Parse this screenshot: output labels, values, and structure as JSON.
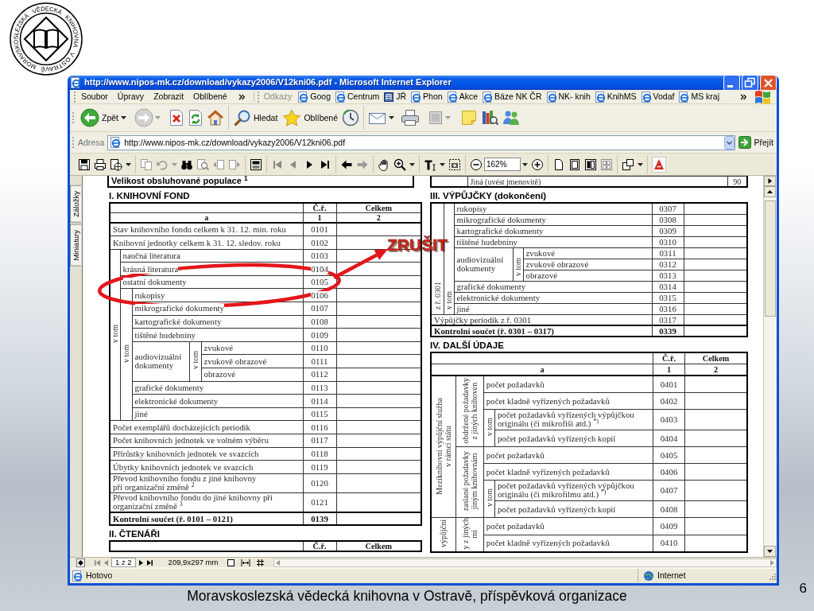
{
  "slide": {
    "logo_text": [
      "MORAVSKOSLEZSKÁ",
      "VĚDECKÁ",
      "KNIHOVNA",
      "V OSTRAVĚ"
    ]
  },
  "window": {
    "title": "http://www.nipos-mk.cz/download/vykazy2006/V12kni06.pdf - Microsoft Internet Explorer"
  },
  "menu": [
    "Soubor",
    "Úpravy",
    "Zobrazit",
    "Oblíbené"
  ],
  "links": {
    "label": "Odkazy",
    "items": [
      "Goog",
      "Centrum",
      "JŘ",
      "Phon",
      "Akce",
      "Báze NK ČR",
      "NK- knih",
      "KnihMS",
      "Vodaf",
      "MS kraj"
    ]
  },
  "toolbar": {
    "back": "Zpět",
    "search": "Hledat",
    "favorites": "Oblíbené"
  },
  "address_bar": {
    "label": "Adresa",
    "value": "http://www.nipos-mk.cz/download/vykazy2006/V12kni06.pdf",
    "go": "Přejít"
  },
  "pdf_toolbar": {
    "zoom": "162%"
  },
  "side_tabs": [
    "Záložky",
    "Miniatury"
  ],
  "document": {
    "left": [
      {
        "kind": "box",
        "text": "Velikost obsluhované populace $^{1}$"
      },
      {
        "kind": "heading",
        "text": "I. KNIHOVNÍ FOND"
      },
      {
        "kind": "table",
        "columns": [
          "Č.ř.",
          "Celkem"
        ],
        "keys": [
          "a",
          "1",
          "2"
        ],
        "rows": [
          {
            "label": "Stav knihovního fondu celkem k 31. 12. min. roku",
            "code": "0101"
          },
          {
            "label": "Knihovní jednotky celkem k 31. 12. sledov. roku",
            "code": "0102"
          },
          {
            "vlabel": "v tom",
            "children": [
              {
                "label": "naučná literatura",
                "code": "0103"
              },
              {
                "label": "krásná literatura",
                "code": "0104"
              },
              {
                "label": "ostatní dokumenty",
                "code": "0105"
              },
              {
                "vlabel": "v tom",
                "children": [
                  {
                    "label": "rukopisy",
                    "code": "0106"
                  },
                  {
                    "label": "mikrografické dokumenty",
                    "code": "0107"
                  },
                  {
                    "label": "kartografické dokumenty",
                    "code": "0108"
                  },
                  {
                    "label": "tištěné hudebniny",
                    "code": "0109"
                  },
                  {
                    "label": "audiovizuální dokumenty",
                    "vlabel": "v tom",
                    "children": [
                      {
                        "label": "zvukové",
                        "code": "0110"
                      },
                      {
                        "label": "zvukově obrazové",
                        "code": "0111"
                      },
                      {
                        "label": "obrazové",
                        "code": "0112"
                      }
                    ]
                  },
                  {
                    "label": "grafické dokumenty",
                    "code": "0113"
                  },
                  {
                    "label": "elektronické dokumenty",
                    "code": "0114"
                  },
                  {
                    "label": "jiné",
                    "code": "0115"
                  }
                ]
              }
            ]
          },
          {
            "label": "Počet exemplářů docházejících periodik",
            "code": "0116"
          },
          {
            "label": "Počet knihovních jednotek ve volném výběru",
            "code": "0117"
          },
          {
            "label": "Přírůstky knihovních jednotek ve svazcích",
            "code": "0118"
          },
          {
            "label": "Úbytky knihovních jednotek ve svazcích",
            "code": "0119"
          },
          {
            "label": "Převod knihovního fondu z jiné knihovny\npři organizační změně $^{2}$",
            "code": "0120"
          },
          {
            "label": "Převod knihovního fondu do jiné knihovny při\norganizační změně $^{3}$",
            "code": "0121"
          }
        ],
        "total": {
          "label": "Kontrolní součet (ř. 0101 – 0121)",
          "code": "0139"
        }
      },
      {
        "kind": "heading",
        "text": "II. ČTENÁŘI"
      },
      {
        "kind": "table_head",
        "columns": [
          "Č.ř.",
          "Celkem"
        ]
      }
    ],
    "right": [
      {
        "kind": "cut_row",
        "text": "Jiná (uvést jmenovitě)",
        "value": "90"
      },
      {
        "kind": "heading",
        "text": "III. VÝPŮJČKY (dokončení)"
      },
      {
        "kind": "table",
        "rows": [
          {
            "vlabel": "z ř. 0301",
            "children": [
              {
                "vlabel": "v tom",
                "children": [
                  {
                    "label": "rukopisy",
                    "code": "0307"
                  },
                  {
                    "label": "mikrografické dokumenty",
                    "code": "0308"
                  },
                  {
                    "label": "kartografické dokumenty",
                    "code": "0309"
                  },
                  {
                    "label": "tištěné hudebniny",
                    "code": "0310"
                  },
                  {
                    "label": "audiovizuální dokumenty",
                    "vlabel": "v tom",
                    "children": [
                      {
                        "label": "zvukové",
                        "code": "0311"
                      },
                      {
                        "label": "zvukově obrazové",
                        "code": "0312"
                      },
                      {
                        "label": "obrazové",
                        "code": "0313"
                      }
                    ]
                  },
                  {
                    "label": "grafické dokumenty",
                    "code": "0314"
                  },
                  {
                    "label": "elektronické dokumenty",
                    "code": "0315"
                  },
                  {
                    "label": "jiné",
                    "code": "0316"
                  }
                ]
              }
            ]
          },
          {
            "label": "Výpůjčky periodik z ř. 0301",
            "code": "0317"
          }
        ],
        "total": {
          "label": "Kontrolní součet (ř. 0301 – 0317)",
          "code": "0339"
        }
      },
      {
        "kind": "heading",
        "text": "IV. DALŠÍ ÚDAJE"
      },
      {
        "kind": "table",
        "columns": [
          "Č.ř.",
          "Celkem"
        ],
        "keys": [
          "a",
          "1",
          "2"
        ],
        "rows": [
          {
            "vlabel": "Meziknihovní výpůjční služba\nv rámci státu",
            "children": [
              {
                "vlabel": "obdržené požadavky\nz jiných knihoven",
                "children": [
                  {
                    "label": "počet požadavků",
                    "code": "0401"
                  },
                  {
                    "label": "počet kladně vyřízených požadavků",
                    "code": "0402"
                  },
                  {
                    "vlabel": "v tom",
                    "children": [
                      {
                        "label": "počet požadavků vyřízených výpůjčkou originálu (či mikrofiši atd.) $^{*)}$",
                        "code": "0403"
                      },
                      {
                        "label": "počet požadavků vyřízených kopií",
                        "code": "0404"
                      }
                    ]
                  }
                ]
              },
              {
                "vlabel": "zaslané požadavky\njiným knihovnám",
                "children": [
                  {
                    "label": "počet požadavků",
                    "code": "0405"
                  },
                  {
                    "label": "počet kladně vyřízených požadavků",
                    "code": "0406"
                  },
                  {
                    "vlabel": "v tom",
                    "children": [
                      {
                        "label": "počet požadavků vyřízených výpůjčkou originálu (či mikrofilmu atd.) $^{*)}$",
                        "code": "0407"
                      },
                      {
                        "label": "počet požadavků vyřízených kopií",
                        "code": "0408"
                      }
                    ]
                  }
                ]
              }
            ]
          },
          {
            "vlabel": "výpůjční",
            "children": [
              {
                "vlabel": "y z jiných\nmi",
                "children": [
                  {
                    "label": "počet požadavků",
                    "code": "0409"
                  },
                  {
                    "label": "počet kladně vyřízených požadavků",
                    "code": "0410"
                  }
                ]
              }
            ]
          }
        ]
      }
    ]
  },
  "pdf_status": {
    "page": "1 z 2",
    "page_size": "209,9x297 mm"
  },
  "status_bar": {
    "text": "Hotovo",
    "zone": "Internet"
  },
  "annotation": {
    "label": "ZRUŠIT"
  },
  "footer": {
    "text": "Moravskoslezská vědecká knihovna v Ostravě, příspěvková organizace",
    "page_number": "6"
  }
}
